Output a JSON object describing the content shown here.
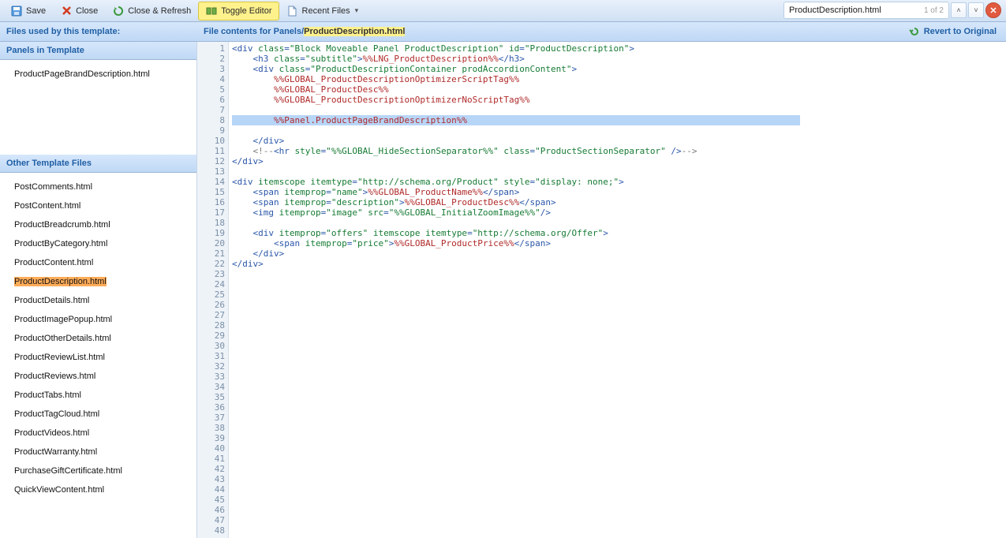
{
  "toolbar": {
    "save": "Save",
    "close": "Close",
    "close_refresh": "Close & Refresh",
    "toggle_editor": "Toggle Editor",
    "recent_files": "Recent Files"
  },
  "search": {
    "text": "ProductDescription.html",
    "counter": "1 of 2"
  },
  "subbar": {
    "left": "Files used by this template:",
    "mid_prefix": "File contents for Panels/",
    "mid_file": "ProductDescription.html",
    "revert": "Revert to Original"
  },
  "sidebar": {
    "panels_header": "Panels in Template",
    "panels_items": [
      "ProductPageBrandDescription.html"
    ],
    "other_header": "Other Template Files",
    "other_items": [
      "PostComments.html",
      "PostContent.html",
      "ProductBreadcrumb.html",
      "ProductByCategory.html",
      "ProductContent.html",
      "ProductDescription.html",
      "ProductDetails.html",
      "ProductImagePopup.html",
      "ProductOtherDetails.html",
      "ProductReviewList.html",
      "ProductReviews.html",
      "ProductTabs.html",
      "ProductTagCloud.html",
      "ProductVideos.html",
      "ProductWarranty.html",
      "PurchaseGiftCertificate.html",
      "QuickViewContent.html"
    ],
    "selected": "ProductDescription.html"
  },
  "editor": {
    "total_lines": 48,
    "selected_line": 8
  }
}
